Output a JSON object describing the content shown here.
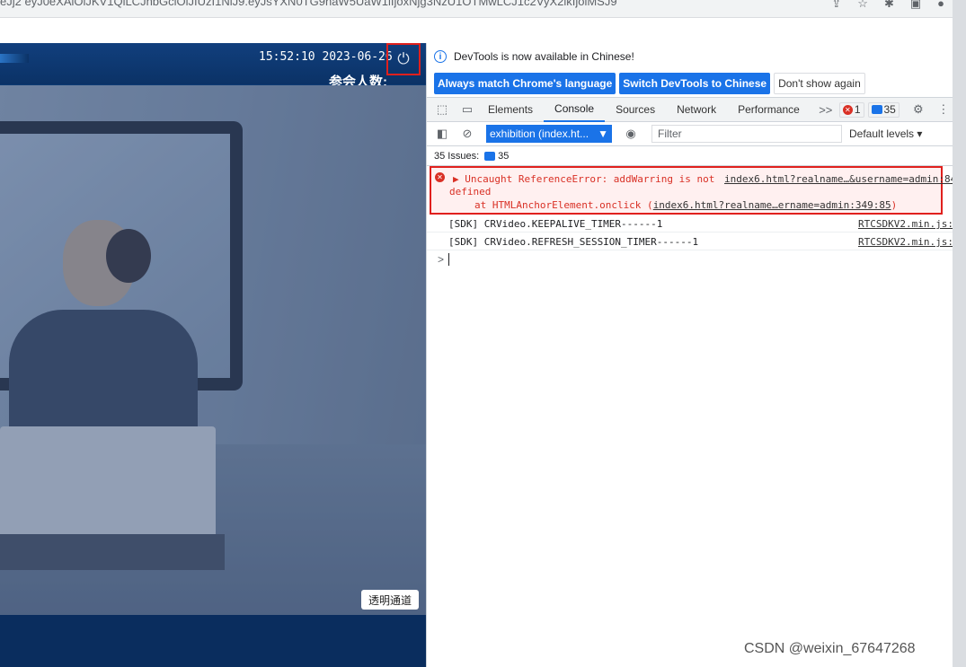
{
  "browser": {
    "url_fragment": "eJj2  eyJ0eXAiOiJKV1QiLCJhbGciOiJIUzI1NiJ9.eyJsYXN0TG9naW5UaW1lIjoxNjg3NzU1OTMwLCJ1c2VyX2lkIjoiMSJ9",
    "icons": [
      "share-icon",
      "star-icon",
      "extension-icon",
      "window-icon",
      "profile-icon"
    ]
  },
  "app": {
    "clock": "15:52:10 2023-06-26",
    "attendee_label": "参会人数:",
    "transparent_channel_button": "透明通道",
    "colors": {
      "header": "#0b3266",
      "power_highlight": "#e0201d"
    }
  },
  "devtools": {
    "notice": "DevTools is now available in Chinese!",
    "buttons": {
      "match_language": "Always match Chrome's language",
      "switch_chinese": "Switch DevTools to Chinese",
      "dont_show": "Don't show again"
    },
    "tabs": [
      "Elements",
      "Console",
      "Sources",
      "Network",
      "Performance"
    ],
    "active_tab": "Console",
    "more_tabs": ">>",
    "error_count": "1",
    "message_count": "35",
    "context": "exhibition (index.ht...",
    "filter_placeholder": "Filter",
    "levels": "Default levels ▾",
    "issues_label": "35 Issues:",
    "issues_count": "35",
    "error": {
      "line1": "▶ Uncaught ReferenceError: addWarring is not",
      "line2": "defined",
      "line3_prefix": "at HTMLAnchorElement.onclick (",
      "line3_link": "index6.html?realname…ername=admin:349:85",
      "line3_suffix": ")",
      "source": "index6.html?realname…&username=admin:84"
    },
    "logs": [
      {
        "msg": "[SDK] CRVideo.KEEPALIVE_TIMER------1",
        "src": "RTCSDKV2.min.js:"
      },
      {
        "msg": "[SDK] CRVideo.REFRESH_SESSION_TIMER------1",
        "src": "RTCSDKV2.min.js:"
      }
    ],
    "prompt": ">"
  },
  "watermark": "CSDN @weixin_67647268"
}
